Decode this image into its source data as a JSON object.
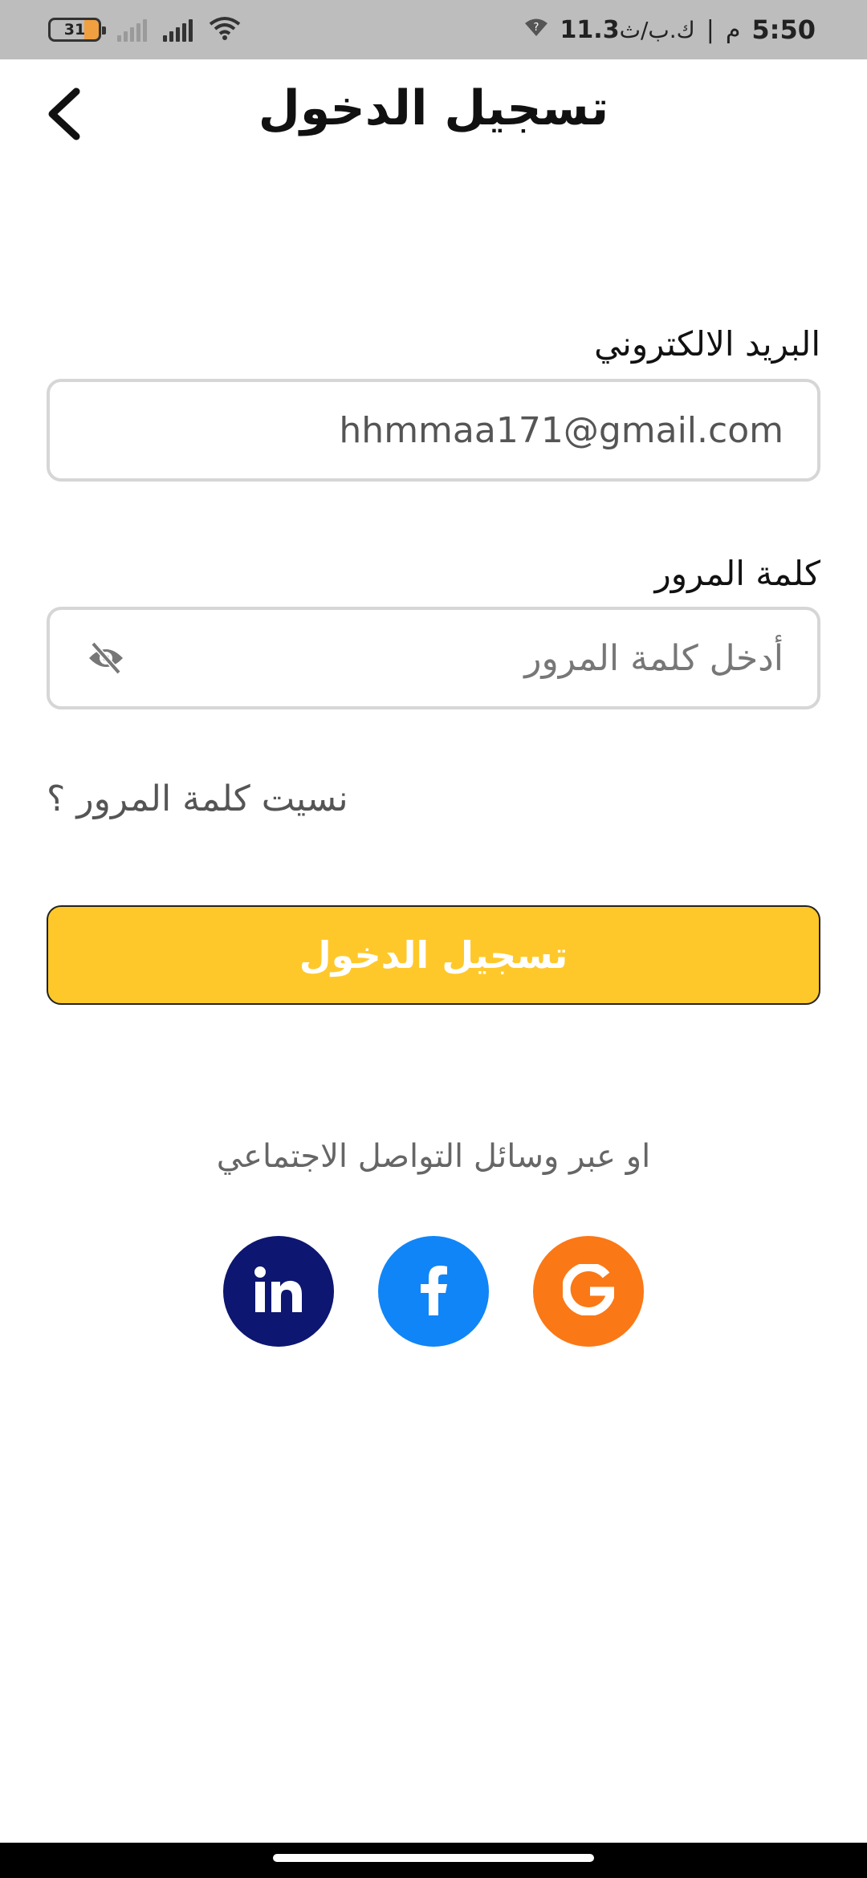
{
  "status_bar": {
    "battery": "31",
    "time": "5:50",
    "am_pm": "م",
    "speed_value": "11.3",
    "speed_unit": "ك.ب/ث"
  },
  "header": {
    "title": "تسجيل الدخول",
    "back_icon": "chevron-left-icon"
  },
  "form": {
    "email_label": "البريد الالكتروني",
    "email_value": "hhmmaa171@gmail.com",
    "password_label": "كلمة المرور",
    "password_placeholder": "أدخل كلمة المرور",
    "password_toggle_icon": "eye-off-icon",
    "forgot_password": "نسيت كلمة المرور ؟",
    "submit_label": "تسجيل الدخول"
  },
  "social": {
    "caption": "او عبر وسائل التواصل الاجتماعي",
    "providers": [
      {
        "name": "linkedin",
        "icon": "linkedin-icon",
        "color": "#0d1670"
      },
      {
        "name": "facebook",
        "icon": "facebook-icon",
        "color": "#1085f7"
      },
      {
        "name": "google",
        "icon": "google-icon",
        "color": "#fb7816"
      }
    ]
  },
  "colors": {
    "accent": "#ffc82a",
    "status_bar_bg": "#bdbdbd",
    "input_border": "#d6d6d6"
  }
}
